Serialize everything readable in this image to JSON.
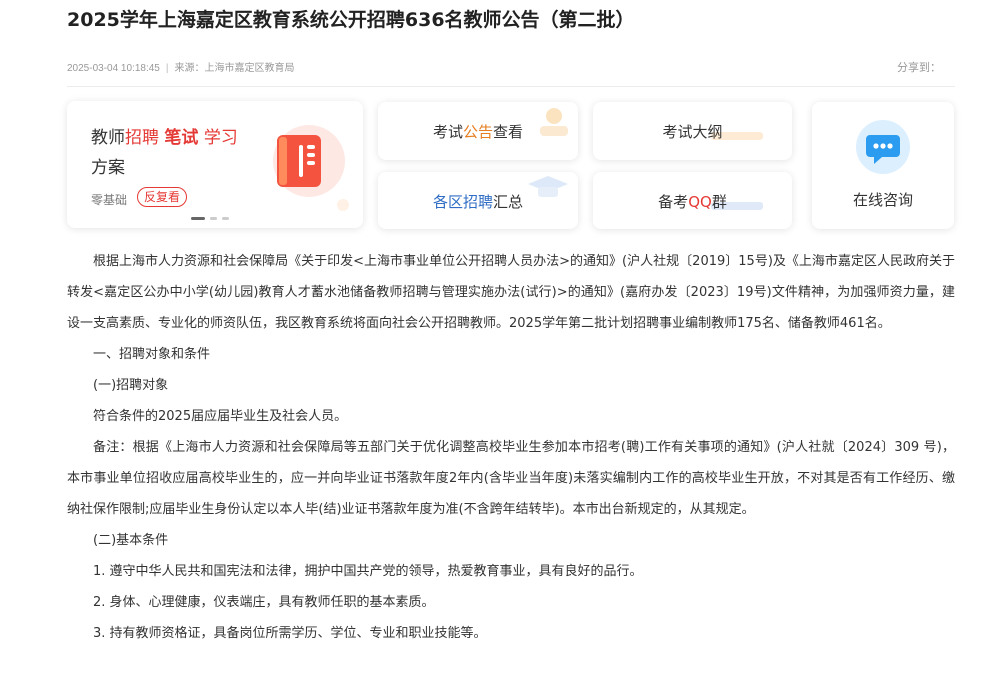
{
  "article": {
    "title": "2025学年上海嘉定区教育系统公开招聘636名教师公告（第二批）",
    "datetime": "2025-03-04 10:18:45",
    "source": "来源：上海市嘉定区教育局",
    "share_label": "分享到："
  },
  "banner": {
    "part1": "教师",
    "part2": "招聘",
    "part3": "笔试",
    "part4": "学习",
    "line2": "方案",
    "tag1": "零基础",
    "tag2": "反复看"
  },
  "tiles": {
    "exam_pre": "考试",
    "exam_hl": "公告",
    "exam_post": "查看",
    "outline": "考试大纲",
    "district_hl": "各区招聘",
    "district_post": "汇总",
    "qq_pre": "备考",
    "qq_hl": "QQ",
    "qq_post": "群",
    "consult": "在线咨询"
  },
  "content": {
    "p1": "根据上海市人力资源和社会保障局《关于印发<上海市事业单位公开招聘人员办法>的通知》(沪人社规〔2019〕15号)及《上海市嘉定区人民政府关于转发<嘉定区公办中小学(幼儿园)教育人才蓄水池储备教师招聘与管理实施办法(试行)>的通知》(嘉府办发〔2023〕19号)文件精神，为加强师资力量，建设一支高素质、专业化的师资队伍，我区教育系统将面向社会公开招聘教师。2025学年第二批计划招聘事业编制教师175名、储备教师461名。",
    "p2": "一、招聘对象和条件",
    "p3": "(一)招聘对象",
    "p4": "符合条件的2025届应届毕业生及社会人员。",
    "p5": "备注：根据《上海市人力资源和社会保障局等五部门关于优化调整高校毕业生参加本市招考(聘)工作有关事项的通知》(沪人社就〔2024〕309 号)，本市事业单位招收应届高校毕业生的，应一并向毕业证书落款年度2年内(含毕业当年度)未落实编制内工作的高校毕业生开放，不对其是否有工作经历、缴纳社保作限制;应届毕业生身份认定以本人毕(结)业证书落款年度为准(不含跨年结转毕)。本市出台新规定的，从其规定。",
    "p6": "(二)基本条件",
    "p7": "1. 遵守中华人民共和国宪法和法律，拥护中国共产党的领导，热爱教育事业，具有良好的品行。",
    "p8": "2. 身体、心理健康，仪表端庄，具有教师任职的基本素质。",
    "p9": "3. 持有教师资格证，具备岗位所需学历、学位、专业和职业技能等。"
  },
  "colors": {
    "accent_red": "#e53935",
    "accent_orange": "#e67e22",
    "accent_blue": "#2f6ec4"
  },
  "icons": {
    "banner": "book-icon",
    "consult": "chat-bubble-icon"
  }
}
